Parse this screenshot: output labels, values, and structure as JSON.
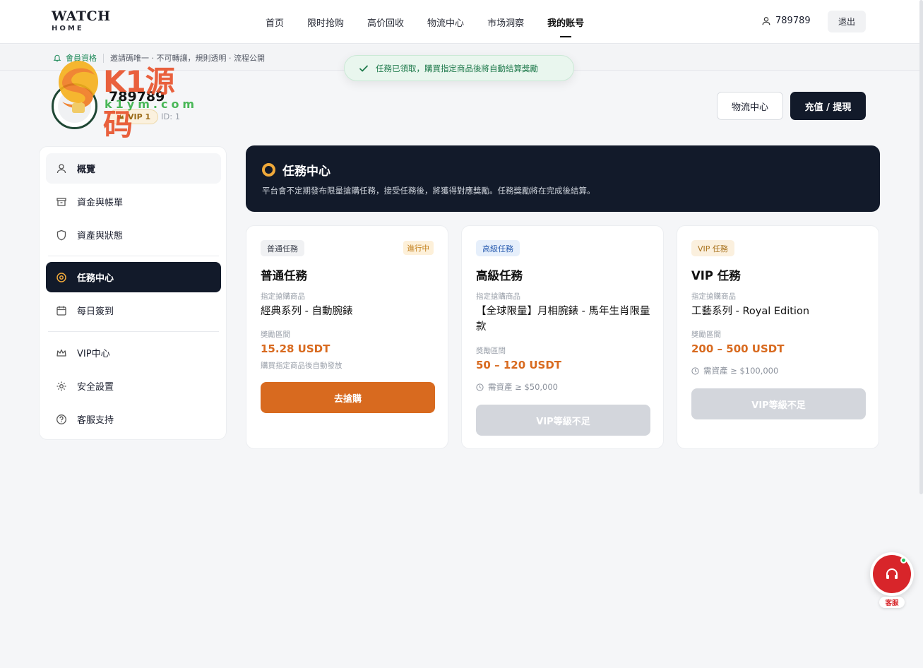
{
  "brand": {
    "name": "WATCH",
    "sub": "HOME"
  },
  "nav": {
    "items": [
      "首页",
      "限时抢购",
      "高价回收",
      "物流中心",
      "市场洞察",
      "我的账号"
    ],
    "active_index": 5
  },
  "user": {
    "name": "789789",
    "logout": "退出"
  },
  "subbar": {
    "member": "會員資格",
    "text": "邀請碼唯一 · 不可轉讓，規則透明 · 流程公開"
  },
  "toast": {
    "text": "任務已領取，購買指定商品後將自動結算獎勵"
  },
  "watermark": {
    "text": "K1源码",
    "url": "k1ym.com"
  },
  "profile": {
    "username": "789789",
    "vip": "VIP 1",
    "id": "ID: 1",
    "btn_logistics": "物流中心",
    "btn_recharge": "充值 / 提現"
  },
  "sidebar": {
    "items": [
      {
        "label": "概覽",
        "icon": "user-icon"
      },
      {
        "label": "資金與帳單",
        "icon": "archive-icon"
      },
      {
        "label": "資產與狀態",
        "icon": "shield-icon"
      },
      {
        "label": "任務中心",
        "icon": "target-icon"
      },
      {
        "label": "每日簽到",
        "icon": "calendar-icon"
      },
      {
        "label": "VIP中心",
        "icon": "crown-icon"
      },
      {
        "label": "安全設置",
        "icon": "gear-icon"
      },
      {
        "label": "客服支持",
        "icon": "help-icon"
      }
    ],
    "active_index": 3
  },
  "task_center": {
    "title": "任務中心",
    "desc": "平台會不定期發布限量搶購任務，接受任務後，將獲得對應獎勵。任務獎勵將在完成後結算。"
  },
  "cards": [
    {
      "tag": "普通任務",
      "status": "進行中",
      "title": "普通任務",
      "product_label": "指定搶購商品",
      "product": "經典系列 - 自動腕錶",
      "reward_label": "獎勵區間",
      "reward": "15.28 USDT",
      "note": "購買指定商品後自動發放",
      "button": "去搶購"
    },
    {
      "tag": "高級任務",
      "title": "高級任務",
      "product_label": "指定搶購商品",
      "product": "【全球限量】月相腕錶 - 馬年生肖限量款",
      "reward_label": "獎勵區間",
      "reward": "50 – 120 USDT",
      "requirement": "需資產 ≥ $50,000",
      "button": "VIP等級不足"
    },
    {
      "tag": "VIP 任務",
      "title": "VIP 任務",
      "product_label": "指定搶購商品",
      "product": "工藝系列 - Royal Edition",
      "reward_label": "獎勵區間",
      "reward": "200 – 500 USDT",
      "requirement": "需資產 ≥ $100,000",
      "button": "VIP等級不足"
    }
  ],
  "support": {
    "label": "客服"
  },
  "colors": {
    "dark": "#121a2a",
    "accent": "#d86a1f",
    "success": "#1f7a4c"
  }
}
